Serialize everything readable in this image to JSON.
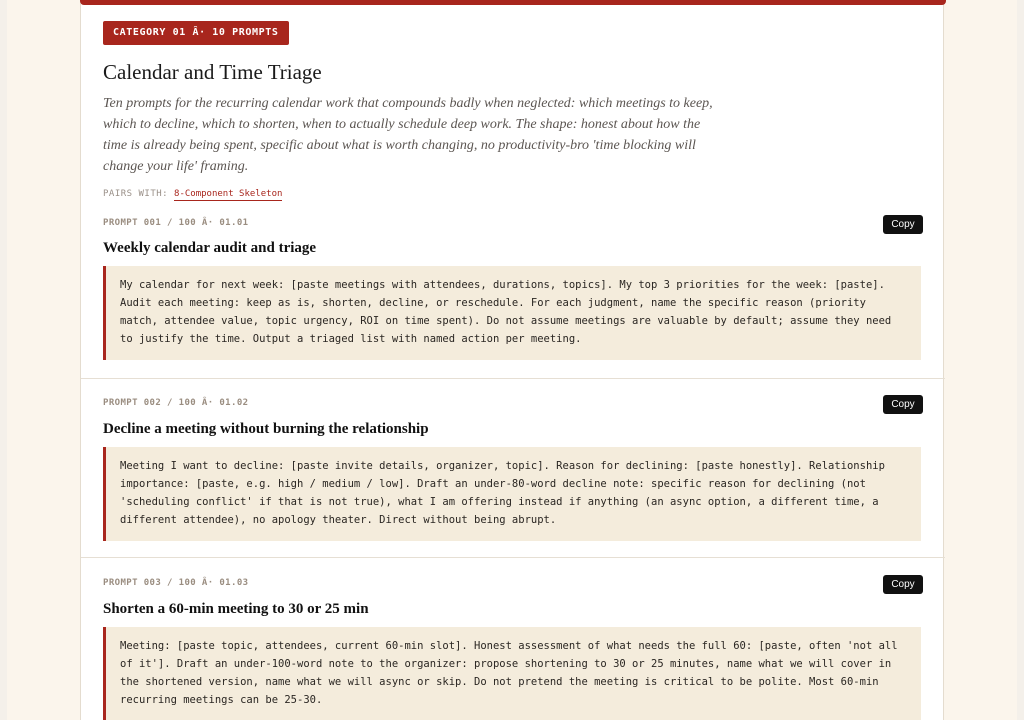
{
  "category": {
    "badge": "CATEGORY 01 Â· 10 PROMPTS",
    "title": "Calendar and Time Triage",
    "description": "Ten prompts for the recurring calendar work that compounds badly when neglected: which meetings to keep, which to decline, which to shorten, when to actually schedule deep work. The shape: honest about how the time is already being spent, specific about what is worth changing, no productivity-bro 'time blocking will change your life' framing.",
    "pairs_label": "PAIRS WITH:",
    "pairs_link": "8-Component Skeleton"
  },
  "copy_label": "Copy",
  "prompts": [
    {
      "meta": "PROMPT 001 / 100 Â· 01.01",
      "title": "Weekly calendar audit and triage",
      "body": "My calendar for next week: [paste meetings with attendees, durations, topics]. My top 3 priorities for the week: [paste]. Audit each meeting: keep as is, shorten, decline, or reschedule. For each judgment, name the specific reason (priority match, attendee value, topic urgency, ROI on time spent). Do not assume meetings are valuable by default; assume they need to justify the time. Output a triaged list with named action per meeting."
    },
    {
      "meta": "PROMPT 002 / 100 Â· 01.02",
      "title": "Decline a meeting without burning the relationship",
      "body": "Meeting I want to decline: [paste invite details, organizer, topic]. Reason for declining: [paste honestly]. Relationship importance: [paste, e.g. high / medium / low]. Draft an under-80-word decline note: specific reason for declining (not 'scheduling conflict' if that is not true), what I am offering instead if anything (an async option, a different time, a different attendee), no apology theater. Direct without being abrupt."
    },
    {
      "meta": "PROMPT 003 / 100 Â· 01.03",
      "title": "Shorten a 60-min meeting to 30 or 25 min",
      "body": "Meeting: [paste topic, attendees, current 60-min slot]. Honest assessment of what needs the full 60: [paste, often 'not all of it']. Draft an under-100-word note to the organizer: propose shortening to 30 or 25 minutes, name what we will cover in the shortened version, name what we will async or skip. Do not pretend the meeting is critical to be polite. Most 60-min recurring meetings can be 25-30."
    }
  ]
}
